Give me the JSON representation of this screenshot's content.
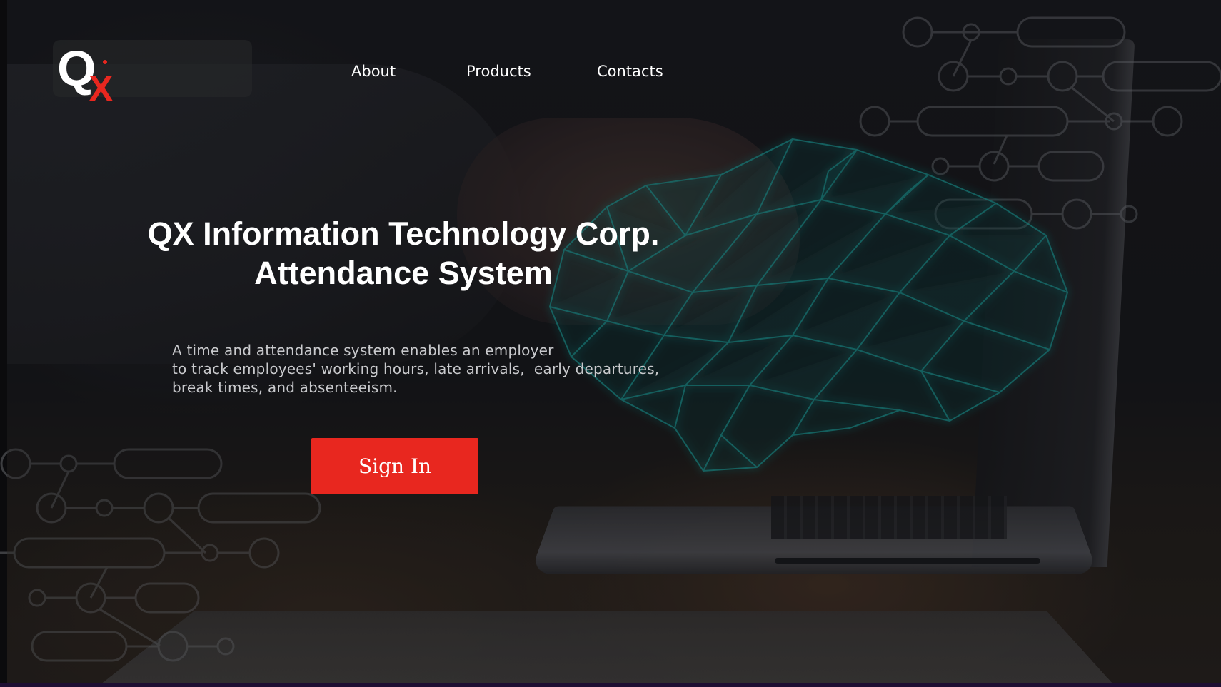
{
  "brand": {
    "logo_letter_q": "Q",
    "logo_letter_x": "X",
    "logo_accent_color": "#e8271f"
  },
  "nav": {
    "items": [
      {
        "label": "About"
      },
      {
        "label": "Products"
      },
      {
        "label": "Contacts"
      }
    ]
  },
  "hero": {
    "title_line1": "QX Information Technology Corp.",
    "title_line2": "Attendance System",
    "description_lines": [
      "A time and attendance system enables an employer",
      "to track employees' working hours, late arrivals,  early departures,",
      "break times, and absenteeism."
    ],
    "signin_label": "Sign In",
    "signin_color": "#e8271f"
  },
  "theme": {
    "background": "#141518",
    "network_hand_color": "#1fb5b0",
    "decor_line_color": "#8a8d92"
  }
}
